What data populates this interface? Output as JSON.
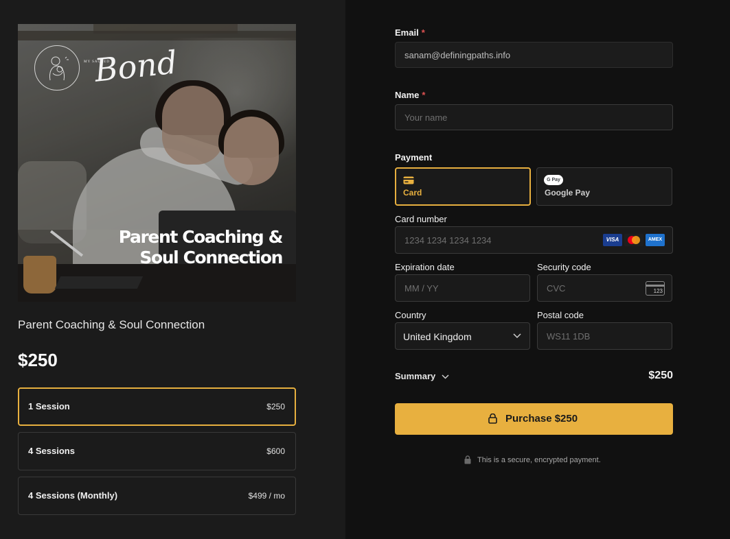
{
  "product": {
    "logo_small_text": "MY SACRED",
    "logo_word": "Bond",
    "image_title_line1": "Parent Coaching &",
    "image_title_line2": "Soul Connection",
    "title": "Parent Coaching & Soul Connection",
    "price": "$250",
    "options": [
      {
        "label": "1 Session",
        "price": "$250",
        "selected": true
      },
      {
        "label": "4 Sessions",
        "price": "$600",
        "selected": false
      },
      {
        "label": "4 Sessions (Monthly)",
        "price": "$499 / mo",
        "selected": false
      }
    ]
  },
  "form": {
    "email_label": "Email",
    "email_value": "sanam@definingpaths.info",
    "name_label": "Name",
    "name_placeholder": "Your name",
    "required_mark": "*",
    "payment_label": "Payment",
    "payment_methods": [
      {
        "label": "Card",
        "icon": "card-icon",
        "selected": true
      },
      {
        "label": "Google Pay",
        "icon": "google-pay-icon",
        "badge": "G Pay",
        "selected": false
      }
    ],
    "card_number_label": "Card number",
    "card_number_placeholder": "1234 1234 1234 1234",
    "card_brands": [
      "VISA",
      "Mastercard",
      "AMEX"
    ],
    "expiry_label": "Expiration date",
    "expiry_placeholder": "MM / YY",
    "cvc_label": "Security code",
    "cvc_placeholder": "CVC",
    "cvc_icon_text": "123",
    "country_label": "Country",
    "country_value": "United Kingdom",
    "postal_label": "Postal code",
    "postal_placeholder": "WS11 1DB"
  },
  "summary": {
    "label": "Summary",
    "total": "$250"
  },
  "purchase_button": "Purchase $250",
  "secure_note": "This is a secure, encrypted payment.",
  "colors": {
    "accent": "#e8b03f",
    "left_bg": "#1b1b1b",
    "right_bg": "#111111",
    "required": "#e05252"
  }
}
